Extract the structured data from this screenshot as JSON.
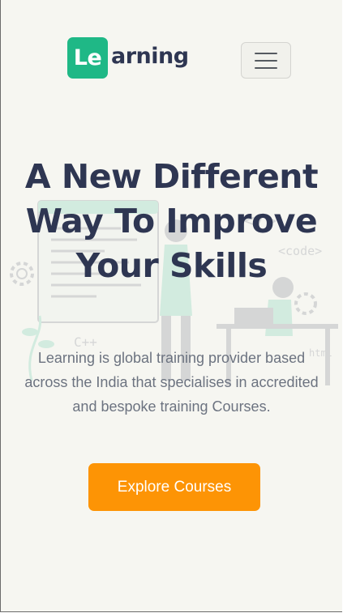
{
  "header": {
    "logo_mark": "Le",
    "logo_text": "arning",
    "menu_icon": "hamburger-menu-icon"
  },
  "hero": {
    "headline": "A New Different Way To Improve Your Skills",
    "description": "Learning is global training provider based across the India that specialises in accredited and bespoke training Courses.",
    "cta_label": "Explore Courses"
  },
  "illustration": {
    "icon": "developer-coding-illustration",
    "labels": [
      "</>",
      "<code>",
      "C++",
      "html"
    ]
  },
  "colors": {
    "brand_green": "#1fb886",
    "heading": "#2e3652",
    "body_text": "#6c7380",
    "cta": "#fd9405",
    "background": "#f6f6f1"
  }
}
